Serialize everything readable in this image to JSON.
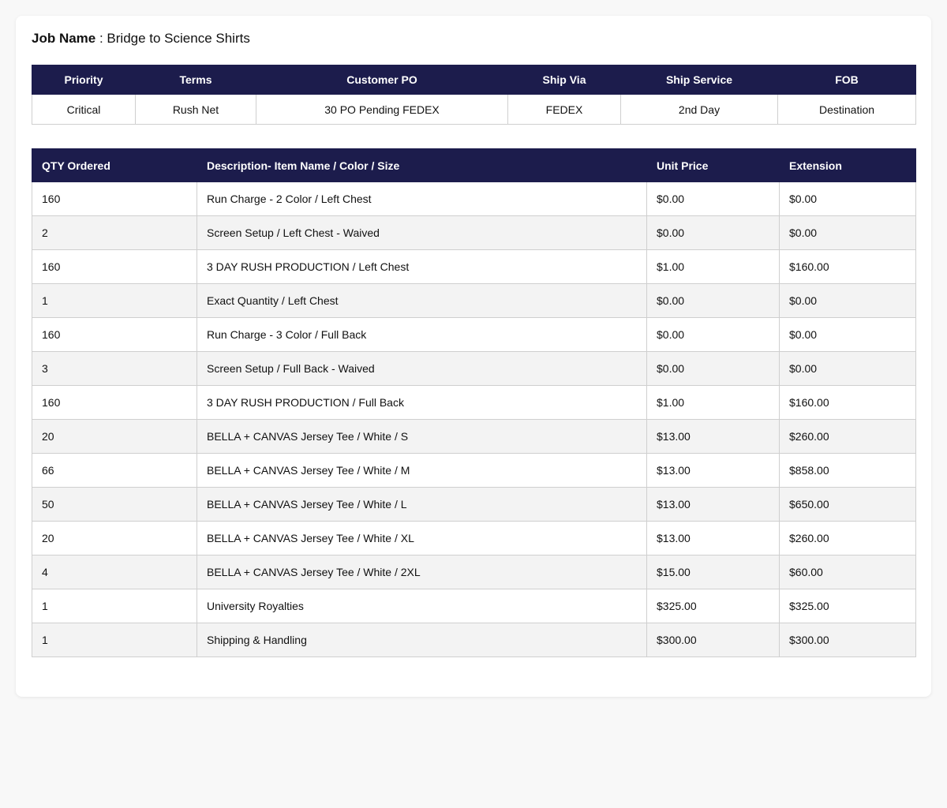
{
  "job": {
    "label": "Job Name",
    "separator": " : ",
    "value": "Bridge to Science Shirts"
  },
  "order_info": {
    "headers": [
      "Priority",
      "Terms",
      "Customer PO",
      "Ship Via",
      "Ship Service",
      "FOB"
    ],
    "values": [
      "Critical",
      "Rush Net",
      "30 PO Pending FEDEX",
      "FEDEX",
      "2nd Day",
      "Destination"
    ]
  },
  "items": {
    "headers": [
      "QTY Ordered",
      "Description- Item Name / Color / Size",
      "Unit Price",
      "Extension"
    ],
    "rows": [
      [
        "160",
        "Run Charge - 2 Color / Left Chest",
        "$0.00",
        "$0.00"
      ],
      [
        "2",
        "Screen Setup / Left Chest - Waived",
        "$0.00",
        "$0.00"
      ],
      [
        "160",
        "3 DAY RUSH PRODUCTION / Left Chest",
        "$1.00",
        "$160.00"
      ],
      [
        "1",
        "Exact Quantity / Left Chest",
        "$0.00",
        "$0.00"
      ],
      [
        "160",
        "Run Charge - 3 Color / Full Back",
        "$0.00",
        "$0.00"
      ],
      [
        "3",
        "Screen Setup / Full Back - Waived",
        "$0.00",
        "$0.00"
      ],
      [
        "160",
        "3 DAY RUSH PRODUCTION / Full Back",
        "$1.00",
        "$160.00"
      ],
      [
        "20",
        "BELLA + CANVAS Jersey Tee / White / S",
        "$13.00",
        "$260.00"
      ],
      [
        "66",
        "BELLA + CANVAS Jersey Tee / White / M",
        "$13.00",
        "$858.00"
      ],
      [
        "50",
        "BELLA + CANVAS Jersey Tee / White / L",
        "$13.00",
        "$650.00"
      ],
      [
        "20",
        "BELLA + CANVAS Jersey Tee / White / XL",
        "$13.00",
        "$260.00"
      ],
      [
        "4",
        "BELLA + CANVAS Jersey Tee / White / 2XL",
        "$15.00",
        "$60.00"
      ],
      [
        "1",
        "University Royalties",
        "$325.00",
        "$325.00"
      ],
      [
        "1",
        "Shipping & Handling",
        "$300.00",
        "$300.00"
      ]
    ]
  },
  "colors": {
    "header_bg": "#1c1c4c",
    "stripe_bg": "#f3f3f3",
    "page_bg": "#f8f8f8"
  }
}
